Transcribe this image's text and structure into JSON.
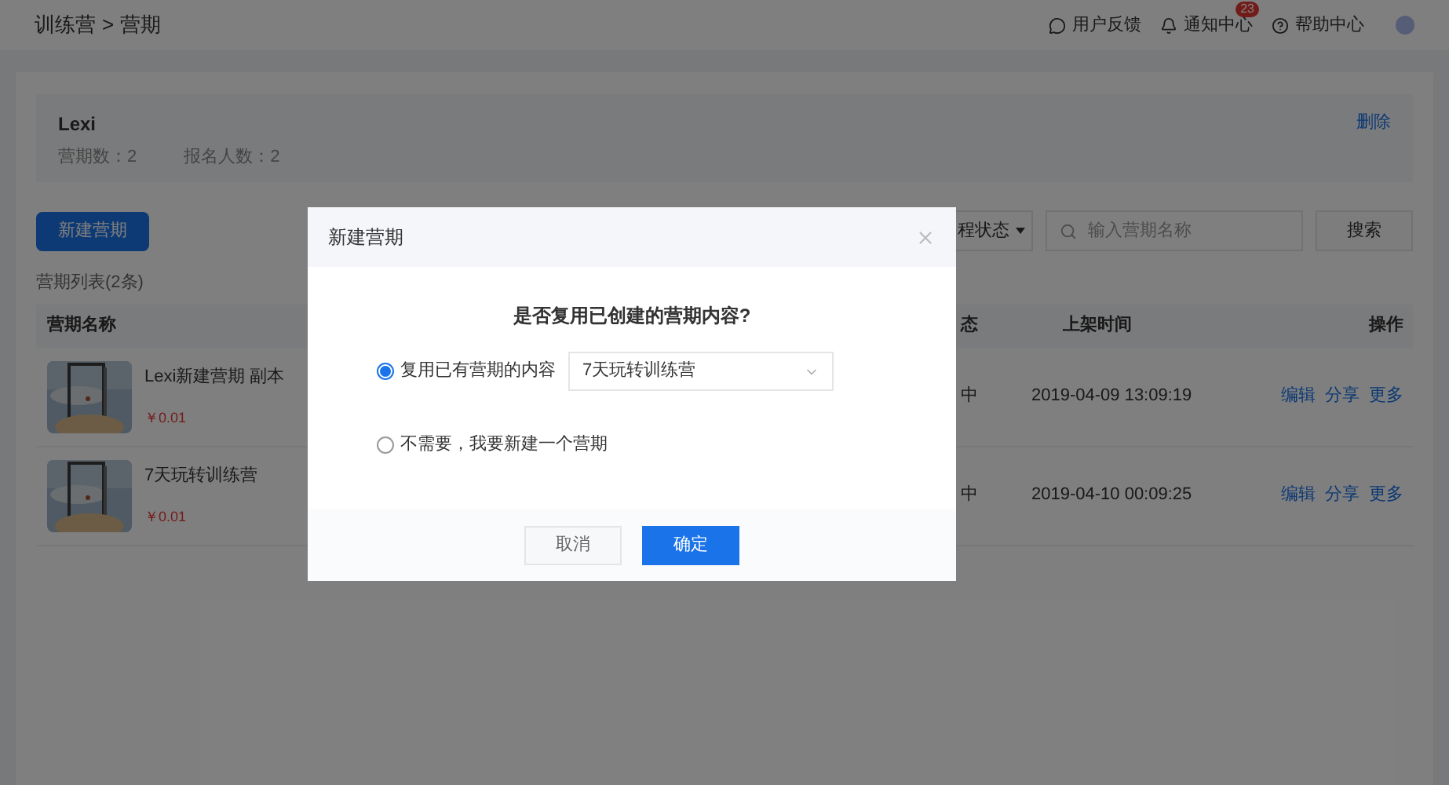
{
  "breadcrumb": {
    "parent": "训练营",
    "separator": ">",
    "current": "营期"
  },
  "header_links": [
    {
      "kind": "feedback",
      "label": "用户反馈"
    },
    {
      "kind": "notice",
      "label": "通知中心",
      "badge": "23"
    },
    {
      "kind": "help",
      "label": "帮助中心"
    }
  ],
  "camp": {
    "name": "Lexi",
    "stats": [
      "营期数：2",
      "报名人数：2"
    ],
    "delete": "删除"
  },
  "new_button": "新建营期",
  "status_filter": "程状态",
  "search": {
    "placeholder": "输入营期名称",
    "button": "搜索"
  },
  "list_title": "营期列表(2条)",
  "table": {
    "columns": [
      "营期名称",
      "态",
      "上架时间",
      "操作"
    ],
    "rows": [
      {
        "name": "Lexi新建营期 副本",
        "price": "￥0.01",
        "status": "中",
        "time": "2019-04-09 13:09:19",
        "actions": [
          "编辑",
          "分享",
          "更多"
        ]
      },
      {
        "name": "7天玩转训练营",
        "price": "￥0.01",
        "status": "中",
        "time": "2019-04-10 00:09:25",
        "actions": [
          "编辑",
          "分享",
          "更多"
        ]
      }
    ]
  },
  "dialog": {
    "title": "新建营期",
    "question": "是否复用已创建的营期内容?",
    "options": [
      {
        "label": "复用已有营期的内容",
        "selected": true,
        "select_value": "7天玩转训练营"
      },
      {
        "label": "不需要，我要新建一个营期",
        "selected": false
      }
    ],
    "buttons": [
      {
        "kind": "secondary",
        "label": "取消"
      },
      {
        "kind": "primary",
        "label": "确定"
      }
    ]
  }
}
